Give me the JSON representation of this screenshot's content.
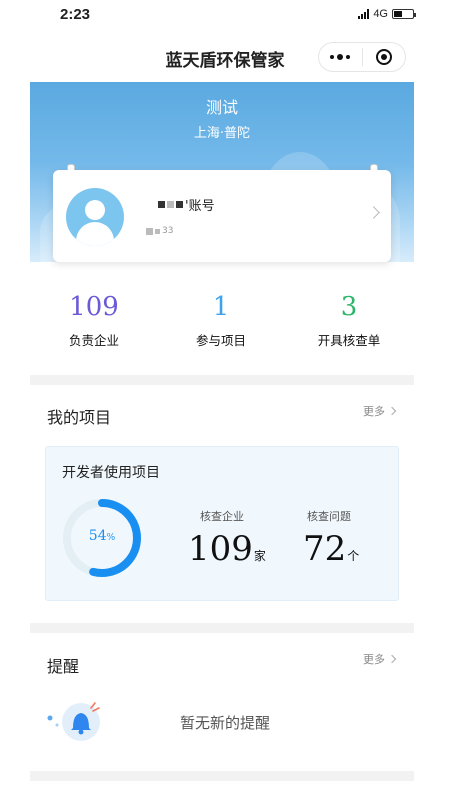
{
  "status_bar": {
    "time": "2:23",
    "network": "4G",
    "battery_level": 0.45
  },
  "nav": {
    "title": "蓝天盾环保管家"
  },
  "banner": {
    "title": "测试",
    "location": "上海·普陀"
  },
  "account": {
    "name_suffix": "'账号",
    "sub_suffix": "33"
  },
  "stats": [
    {
      "value": "109",
      "label": "负责企业",
      "color": "#6b5ad8"
    },
    {
      "value": "1",
      "label": "参与项目",
      "color": "#3fa2ef"
    },
    {
      "value": "3",
      "label": "开具核查单",
      "color": "#2fb56a"
    }
  ],
  "projects": {
    "title": "我的项目",
    "more": "更多",
    "card": {
      "name": "开发者使用项目",
      "progress_value": "54",
      "progress_unit": "%",
      "progress": 0.54,
      "metrics": [
        {
          "label": "核查企业",
          "value": "109",
          "unit": "家"
        },
        {
          "label": "核查问题",
          "value": "72",
          "unit": "个"
        }
      ]
    }
  },
  "reminders": {
    "title": "提醒",
    "more": "更多",
    "empty_text": "暂无新的提醒"
  },
  "colors": {
    "accent": "#1a8ff2",
    "ring_track": "#e3eef5"
  }
}
